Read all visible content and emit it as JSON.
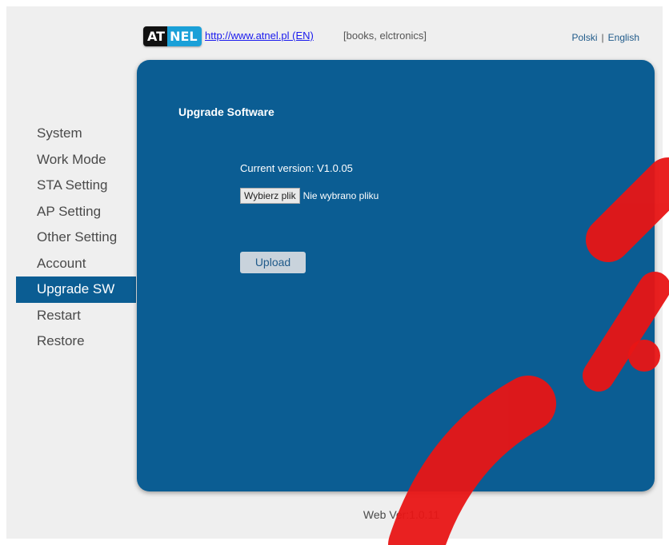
{
  "header": {
    "logo_left": "AT",
    "logo_right": "NEL",
    "site_link": "http://www.atnel.pl (EN)",
    "tagline": "[books, elctronics]",
    "languages": [
      "Polski",
      "English"
    ],
    "lang_separator": "|"
  },
  "sidebar": {
    "items": [
      {
        "label": "System",
        "active": false
      },
      {
        "label": "Work Mode",
        "active": false
      },
      {
        "label": "STA Setting",
        "active": false
      },
      {
        "label": "AP Setting",
        "active": false
      },
      {
        "label": "Other Setting",
        "active": false
      },
      {
        "label": "Account",
        "active": false
      },
      {
        "label": "Upgrade SW",
        "active": true
      },
      {
        "label": "Restart",
        "active": false
      },
      {
        "label": "Restore",
        "active": false
      }
    ]
  },
  "main": {
    "title": "Upgrade Software",
    "current_version": "Current version: V1.0.05",
    "file_button": "Wybierz plik",
    "file_status": "Nie wybrano pliku",
    "upload_button": "Upload"
  },
  "footer": {
    "web_version": "Web Ver:1.0.11"
  },
  "colors": {
    "panel": "#0b5d93",
    "active_nav": "#0b5d93",
    "background": "#efefef",
    "watermark": "#e81515"
  }
}
